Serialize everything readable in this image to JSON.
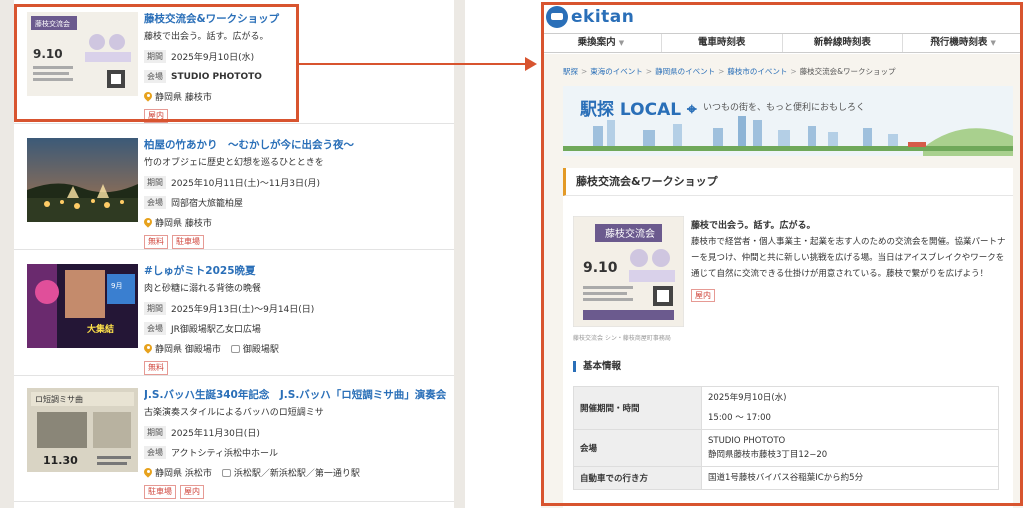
{
  "left_list": {
    "label_period": "期間",
    "label_venue": "会場",
    "items": [
      {
        "title": "藤枝交流会&ワークショップ",
        "subtitle": "藤枝で出会う。話す。広がる。",
        "period": "2025年9月10日(水)",
        "venue": "STUDIO PHOTOTO",
        "location": "静岡県 藤枝市",
        "badges": [
          "屋内"
        ],
        "poster": {
          "big_title": "藤枝交流会",
          "date": "9.10",
          "sub": "Let's meet up"
        }
      },
      {
        "title": "柏屋の竹あかり　～むかしが今に出会う夜～",
        "subtitle": "竹のオブジェに歴史と幻想を巡るひとときを",
        "period": "2025年10月11日(土)～11月3日(月)",
        "venue": "岡部宿大旅籠柏屋",
        "location": "静岡県 藤枝市",
        "badges": [
          "無料",
          "駐車場"
        ]
      },
      {
        "title": "#しゅがミト2025晩夏",
        "subtitle": "肉と砂糖に溺れる背徳の晩餐",
        "period": "2025年9月13日(土)～9月14日(日)",
        "venue": "JR御殿場駅乙女口広場",
        "location": "静岡県 御殿場市",
        "station": "御殿場駅",
        "badges": [
          "無料"
        ],
        "poster": {
          "a": "9月",
          "b": "大集結"
        }
      },
      {
        "title": "J.S.バッハ生誕340年記念　J.S.バッハ「ロ短調ミサ曲」演奏会",
        "subtitle": "古楽演奏スタイルによるバッハのロ短調ミサ",
        "period": "2025年11月30日(日)",
        "venue": "アクトシティ浜松中ホール",
        "location": "静岡県 浜松市",
        "station": "浜松駅／新浜松駅／第一通り駅",
        "badges": [
          "駐車場",
          "屋内"
        ],
        "poster": {
          "a": "ロ短調ミサ曲",
          "b": "11.30"
        }
      }
    ]
  },
  "right": {
    "logo": "ekitan",
    "nav": [
      {
        "label": "乗換案内",
        "caret": "▼"
      },
      {
        "label": "電車時刻表",
        "caret": ""
      },
      {
        "label": "新幹線時刻表",
        "caret": ""
      },
      {
        "label": "飛行機時刻表",
        "caret": "▼"
      }
    ],
    "breadcrumb": [
      "駅探",
      "東海のイベント",
      "静岡県のイベント",
      "藤枝市のイベント"
    ],
    "breadcrumb_sep": ">",
    "breadcrumb_current": "藤枝交流会&ワークショップ",
    "banner": {
      "title": "駅探 LOCAL",
      "subtitle": "いつもの街を、もっと便利におもしろく"
    },
    "event": {
      "title": "藤枝交流会&ワークショップ",
      "catch": "藤枝で出会う。話す。広がる。",
      "description": "藤枝市で経営者・個人事業主・起業を志す人のための交流会を開催。協業パートナーを見つけ、仲間と共に新しい挑戦を広げる場。当日はアイスブレイクやワークを通じて自然に交流できる仕掛けが用意されている。藤枝で繋がりを広げよう！",
      "badge": "屋内",
      "caption": "藤枝交流会 シン・藤枝商屋町事務局"
    },
    "basic_info": {
      "section_title": "基本情報",
      "rows": [
        {
          "label": "開催期間・時間",
          "lines": [
            "2025年9月10日(水)",
            "15:00 ～ 17:00"
          ]
        },
        {
          "label": "会場",
          "lines": [
            "STUDIO PHOTOTO",
            "静岡県藤枝市藤枝3丁目12−20"
          ]
        },
        {
          "label": "自動車での行き方",
          "lines": [
            "国道1号藤枝バイパス谷稲葉ICから約5分"
          ]
        }
      ]
    }
  },
  "colors": {
    "accent": "#d8542f",
    "link": "#2a6fb8",
    "heading_bar": "#e39a27",
    "badge": "#d0463c"
  }
}
